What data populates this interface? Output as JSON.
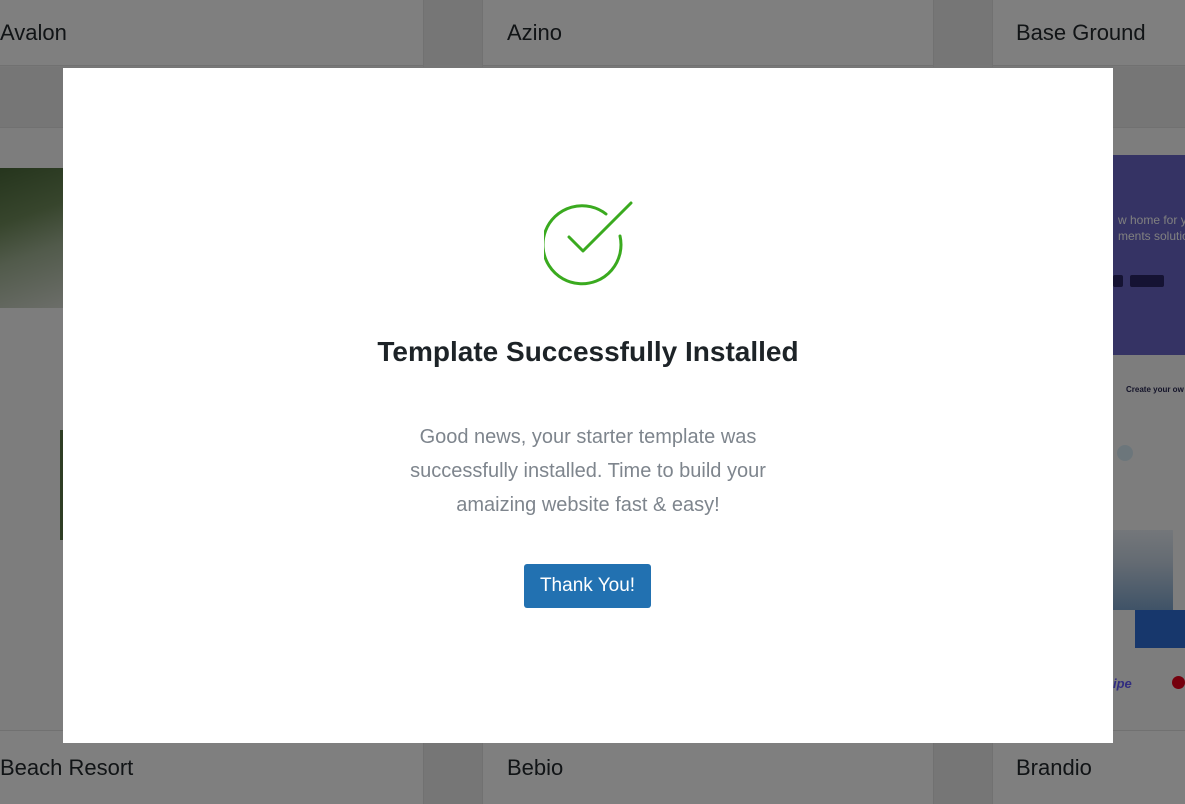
{
  "templates": {
    "top": [
      "Avalon",
      "Azino",
      "Base Ground"
    ],
    "bottom": [
      "Beach Resort",
      "Bebio",
      "Brandio"
    ]
  },
  "preview": {
    "hero_line_1": "w home for y",
    "hero_line_2": "ments solutio",
    "feature_heading": "Create your ow",
    "logo_text": "ipe"
  },
  "modal": {
    "icon": "check-circle-icon",
    "title": "Template Successfully Installed",
    "message": "Good news, your starter template was successfully installed. Time to build your amaizing website fast & easy!",
    "button_label": "Thank You!"
  },
  "colors": {
    "accent": "#2271b1",
    "success": "#3aaa1f",
    "overlay": "rgba(0,0,0,0.5)"
  }
}
